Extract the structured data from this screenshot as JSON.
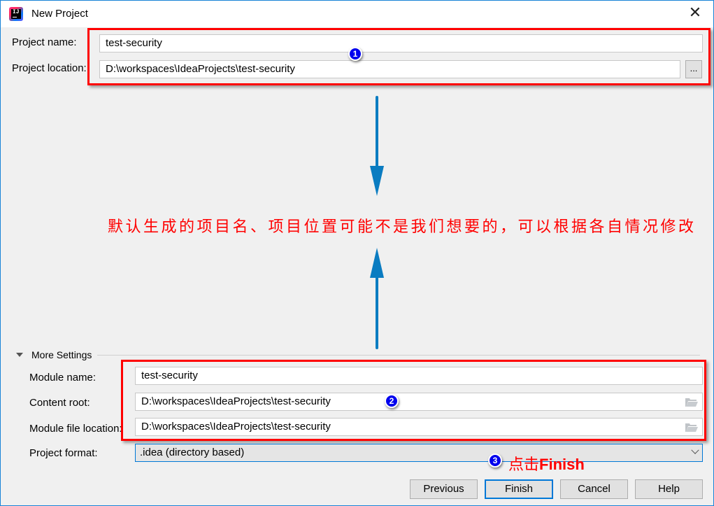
{
  "window": {
    "title": "New Project",
    "app_icon": "intellij-idea-icon",
    "close_icon": "close-icon"
  },
  "project": {
    "name_label": "Project name:",
    "name_value": "test-security",
    "location_label": "Project location:",
    "location_value": "D:\\workspaces\\IdeaProjects\\test-security",
    "browse_label": "..."
  },
  "more_settings": {
    "label": "More Settings",
    "module_name_label": "Module name:",
    "module_name_value": "test-security",
    "content_root_label": "Content root:",
    "content_root_value": "D:\\workspaces\\IdeaProjects\\test-security",
    "module_file_label": "Module file location:",
    "module_file_value": "D:\\workspaces\\IdeaProjects\\test-security",
    "format_label": "Project format:",
    "format_value": ".idea (directory based)"
  },
  "annotations": {
    "badge1": "1",
    "badge2": "2",
    "badge3": "3",
    "center_note": "默认生成的项目名、项目位置可能不是我们想要的，可以根据各自情况修改",
    "finish_prefix": "点击",
    "finish_word": "Finish",
    "highlight_color": "#ff0000",
    "arrow_color": "#0a7cc1"
  },
  "buttons": {
    "previous": "Previous",
    "finish": "Finish",
    "cancel": "Cancel",
    "help": "Help"
  }
}
